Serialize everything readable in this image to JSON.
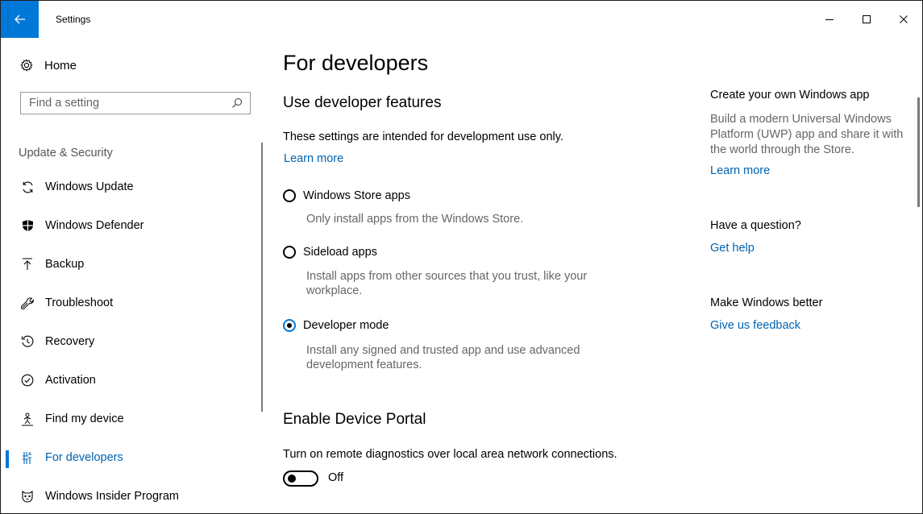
{
  "titlebar": {
    "title": "Settings",
    "back_icon": "back-arrow-icon",
    "controls": [
      "minimize-icon",
      "maximize-icon",
      "close-icon"
    ]
  },
  "sidebar": {
    "home_label": "Home",
    "search_placeholder": "Find a setting",
    "group_label": "Update & Security",
    "items": [
      {
        "label": "Windows Update",
        "icon": "refresh-icon"
      },
      {
        "label": "Windows Defender",
        "icon": "shield-icon"
      },
      {
        "label": "Backup",
        "icon": "upload-arrow-icon"
      },
      {
        "label": "Troubleshoot",
        "icon": "wrench-icon"
      },
      {
        "label": "Recovery",
        "icon": "history-icon"
      },
      {
        "label": "Activation",
        "icon": "check-circle-icon"
      },
      {
        "label": "Find my device",
        "icon": "person-location-icon"
      },
      {
        "label": "For developers",
        "icon": "developer-tools-icon",
        "selected": true
      },
      {
        "label": "Windows Insider Program",
        "icon": "insider-cat-icon"
      }
    ]
  },
  "main": {
    "page_title": "For developers",
    "dev_features": {
      "heading": "Use developer features",
      "intro": "These settings are intended for development use only.",
      "learn_more": "Learn more",
      "options": [
        {
          "label": "Windows Store apps",
          "desc": "Only install apps from the Windows Store.",
          "selected": false
        },
        {
          "label": "Sideload apps",
          "desc": "Install apps from other sources that you trust, like your workplace.",
          "selected": false
        },
        {
          "label": "Developer mode",
          "desc": "Install any signed and trusted app and use advanced development features.",
          "selected": true
        }
      ]
    },
    "device_portal": {
      "heading": "Enable Device Portal",
      "desc": "Turn on remote diagnostics over local area network connections.",
      "toggle_label": "Off",
      "toggle_on": false
    }
  },
  "right_pane": {
    "create_app": {
      "heading": "Create your own Windows app",
      "text": "Build a modern Universal Windows Platform (UWP) app and share it with the world through the Store.",
      "link": "Learn more"
    },
    "question": {
      "heading": "Have a question?",
      "link": "Get help"
    },
    "feedback": {
      "heading": "Make Windows better",
      "link": "Give us feedback"
    }
  },
  "colors": {
    "accent": "#0078d7",
    "link": "#0063b1",
    "secondary_text": "#666666"
  }
}
